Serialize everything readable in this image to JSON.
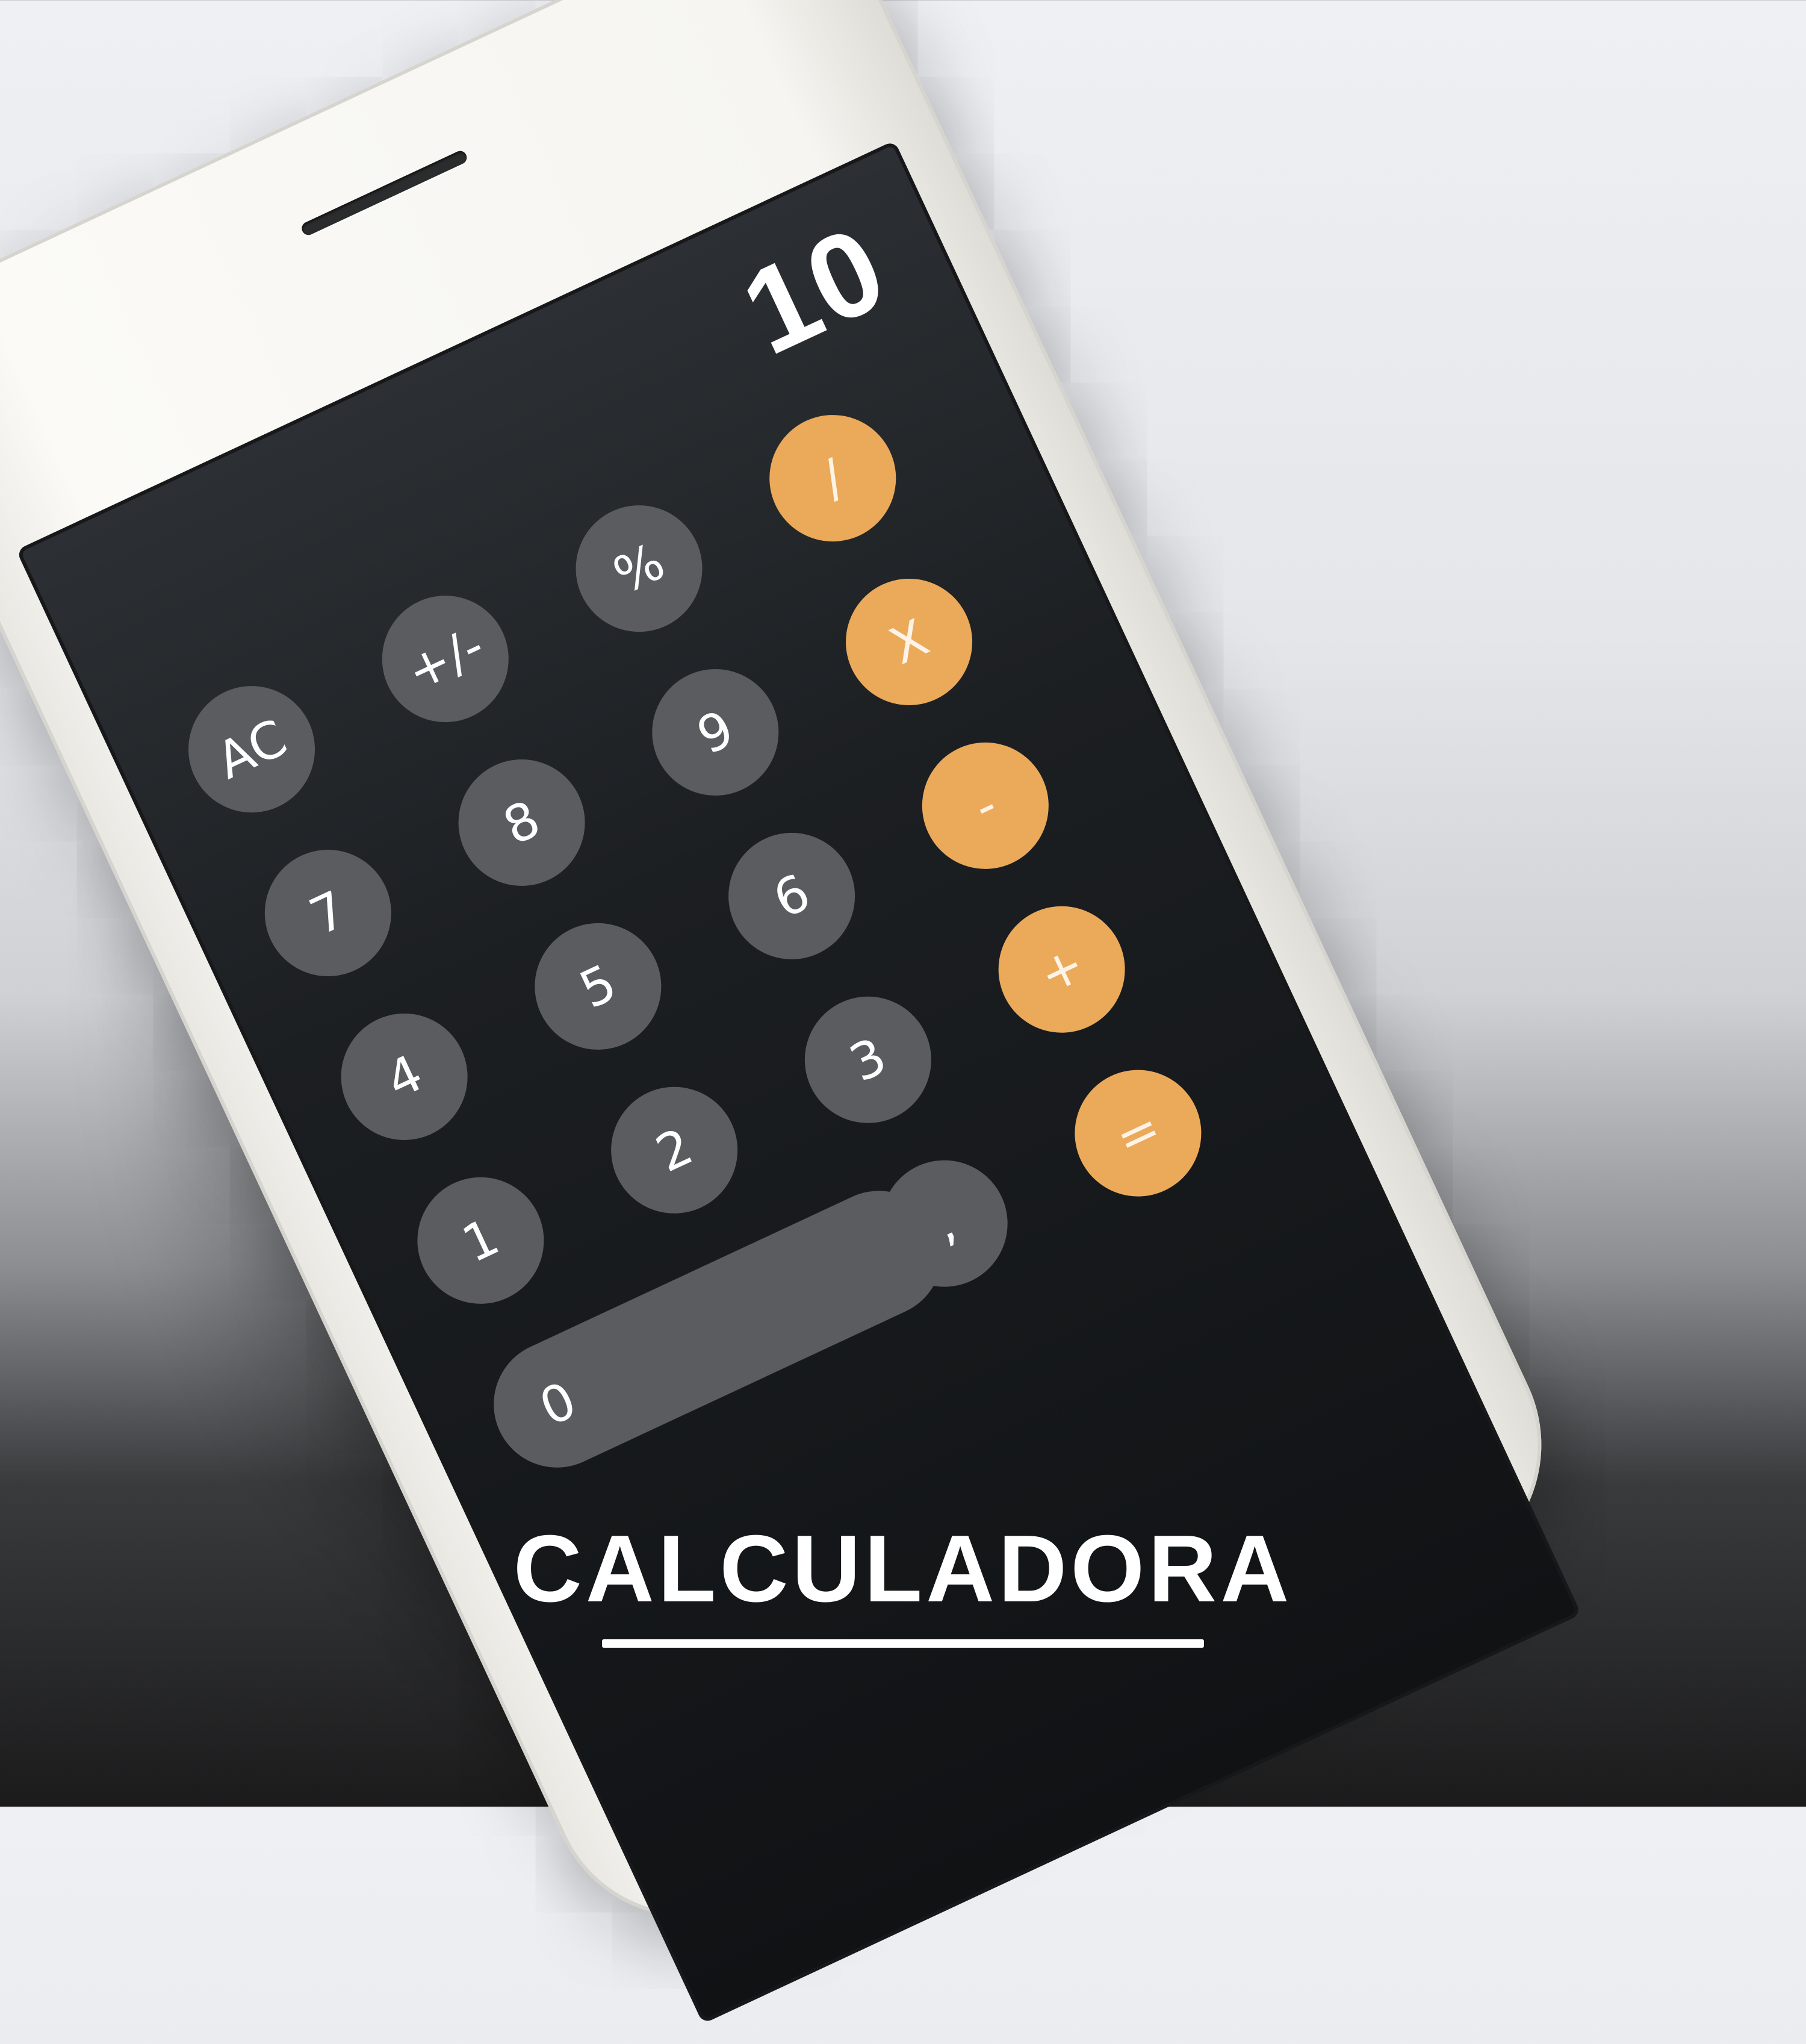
{
  "display": {
    "value": "10"
  },
  "keys": {
    "ac": "AC",
    "plus_minus": "+/-",
    "percent": "%",
    "divide": "/",
    "seven": "7",
    "eight": "8",
    "nine": "9",
    "multiply": "X",
    "four": "4",
    "five": "5",
    "six": "6",
    "minus": "-",
    "one": "1",
    "two": "2",
    "three": "3",
    "plus": "+",
    "zero": "0",
    "decimal": ",",
    "equals": "="
  },
  "banner": {
    "title": "CALCULADORA"
  },
  "colors": {
    "operator_key": "#eba95a",
    "number_key": "#5a5c60",
    "screen": "#1c1f22"
  }
}
